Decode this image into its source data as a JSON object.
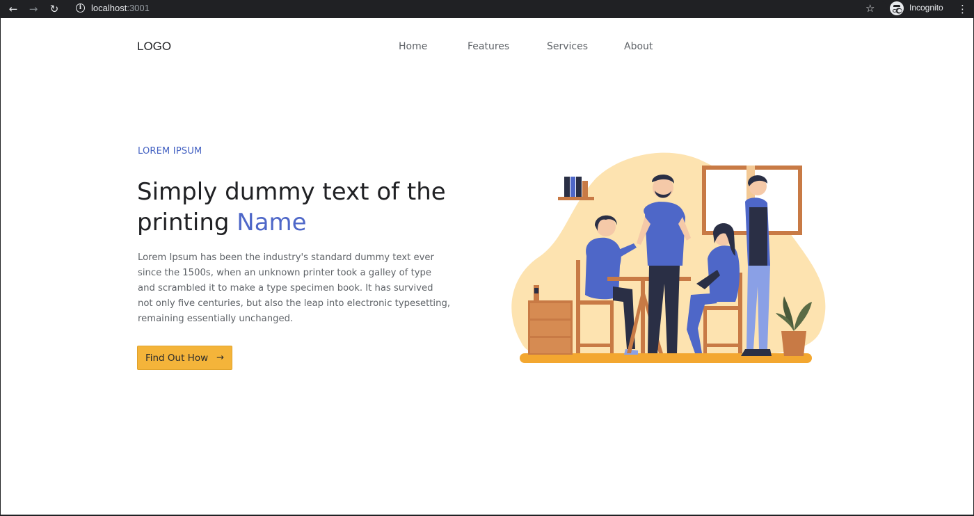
{
  "browser": {
    "url_host": "localhost",
    "url_port": ":3001",
    "profile_label": "Incognito",
    "icons": [
      "back-icon",
      "forward-icon",
      "reload-icon",
      "info-icon",
      "star-icon",
      "incognito-icon",
      "menu-icon"
    ]
  },
  "header": {
    "logo": "LOGO",
    "nav": [
      {
        "label": "Home"
      },
      {
        "label": "Features"
      },
      {
        "label": "Services"
      },
      {
        "label": "About"
      }
    ]
  },
  "hero": {
    "eyebrow": "LOREM IPSUM",
    "headline_main": "Simply dummy text of the printing ",
    "headline_accent": "Name",
    "body": "Lorem Ipsum has been the industry's standard dummy text ever since the 1500s, when an unknown printer took a galley of type and scrambled it to make a type specimen book. It has survived not only five centuries, but also the leap into electronic typesetting, remaining essentially unchanged.",
    "cta_label": "Find Out How",
    "cta_arrow": "→"
  },
  "colors": {
    "accent_blue": "#4e67c8",
    "cta_yellow": "#f4b43a",
    "blob": "#fde3b0",
    "wood": "#c87a45",
    "floor": "#f3a730"
  }
}
